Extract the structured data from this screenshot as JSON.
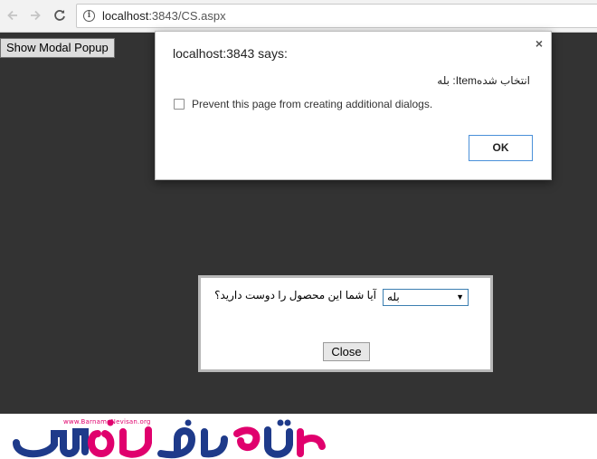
{
  "browser": {
    "url_host": "localhost",
    "url_rest": ":3843/CS.aspx",
    "icons": {
      "back": "arrow-left-icon",
      "forward": "arrow-right-icon",
      "reload": "reload-icon",
      "info": "info-icon"
    }
  },
  "page": {
    "show_modal_label": "Show Modal Popup",
    "overlay_color": "#333333"
  },
  "alert": {
    "title": "localhost:3843 says:",
    "close_glyph": "×",
    "message": "انتخاب شدهItem: بله",
    "checkbox_label": "Prevent this page from creating additional dialogs.",
    "checkbox_checked": false,
    "ok_label": "OK"
  },
  "modal": {
    "question": "آیا شما این محصول را دوست دارید؟",
    "select_value": "بله",
    "close_label": "Close"
  },
  "brand": {
    "site_url": "www.BarnameNevisan.org",
    "colors": {
      "primary": "#1e3a8a",
      "accent": "#e0006d"
    }
  }
}
